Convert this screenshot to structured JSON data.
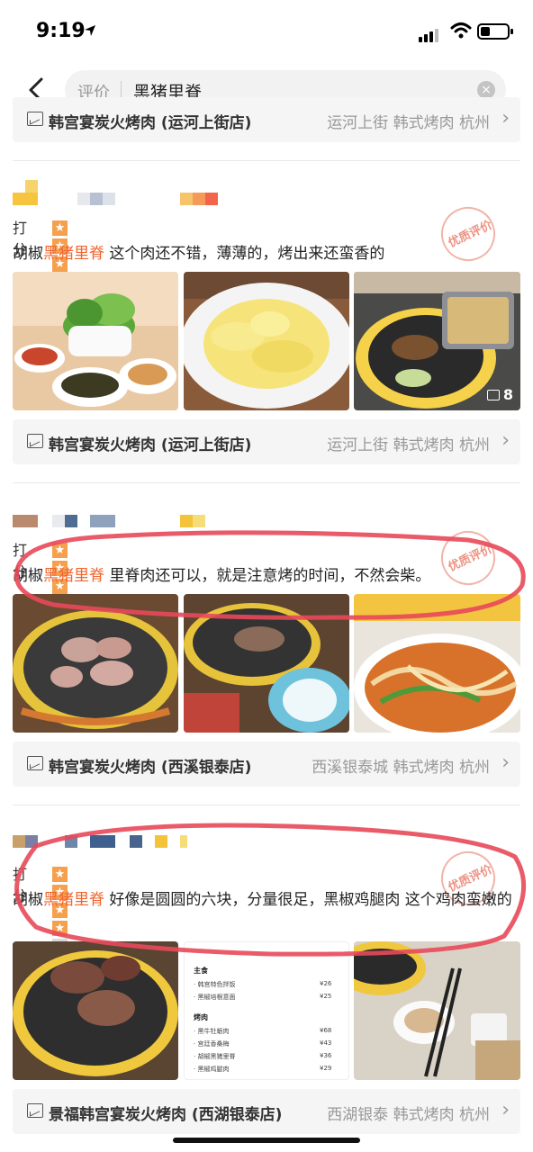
{
  "status_bar": {
    "time": "9:19"
  },
  "search": {
    "scope": "评价",
    "query": "黑猪里脊"
  },
  "reviews": [
    {
      "rating_label": "打分",
      "stars": 4,
      "stamp": "优质评价",
      "pre": "胡椒",
      "keyword": "黑猪里脊",
      "post": " 这个肉还不错，薄薄的，烤出来还蛮香的",
      "photo_count": "8",
      "shop": {
        "name": "韩宫宴炭火烤肉 (运河上街店)",
        "meta": "运河上街 韩式烤肉 杭州"
      }
    },
    {
      "rating_label": "打分",
      "stars": 4,
      "stamp": "优质评价",
      "pre": "胡椒",
      "keyword": "黑猪里脊",
      "post": " 里脊肉还可以，就是注意烤的时间，不然会柴。",
      "shop": {
        "name": "韩宫宴炭火烤肉 (西溪银泰店)",
        "meta": "西溪银泰城 韩式烤肉 杭州"
      }
    },
    {
      "rating_label": "打分",
      "stars": 4,
      "stamp": "优质评价",
      "pre": "胡椒",
      "keyword": "黑猪里脊",
      "post": " 好像是圆圆的六块，分量很足，黑椒鸡腿肉 这个鸡肉蛮嫩的",
      "shop": {
        "name": "景福韩宫宴炭火烤肉 (西湖银泰店)",
        "meta": "西湖银泰 韩式烤肉 杭州"
      }
    }
  ],
  "top_shop": {
    "name": "韩宫宴炭火烤肉 (运河上街店)",
    "meta": "运河上街 韩式烤肉 杭州"
  },
  "menu_photo": {
    "section_main": "主食",
    "section_bbq": "烤肉",
    "items": [
      {
        "name": "韩宫特色拌饭",
        "price": "¥26"
      },
      {
        "name": "黑椒培根意面",
        "price": "¥25"
      },
      {
        "name": "黑牛牡蛎肉",
        "price": "¥68"
      },
      {
        "name": "宫廷香桑梅",
        "price": "¥43"
      },
      {
        "name": "胡椒黑猪里脊",
        "price": "¥36"
      },
      {
        "name": "黑椒鸡腿肉",
        "price": "¥29"
      }
    ]
  },
  "colors": {
    "highlight": "#f0652f",
    "star": "#f6a04d",
    "annotation": "#e8495a"
  }
}
